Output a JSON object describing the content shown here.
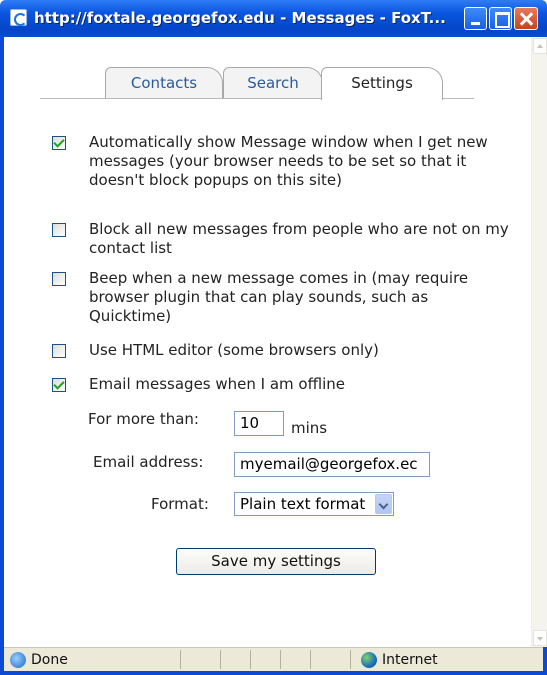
{
  "window": {
    "title": "http://foxtale.georgefox.edu - Messages - FoxT..."
  },
  "tabs": [
    {
      "label": "Contacts",
      "active": false
    },
    {
      "label": "Search",
      "active": false
    },
    {
      "label": "Settings",
      "active": true
    }
  ],
  "options": [
    {
      "label": "Automatically show Message window when I get new messages (your browser needs to be set so that it doesn't block popups on this site)",
      "checked": true
    },
    {
      "label": "Block all new messages from people who are not on my contact list",
      "checked": false
    },
    {
      "label": "Beep when a new message comes in (may require browser plugin that can play sounds, such as Quicktime)",
      "checked": false
    },
    {
      "label": "Use HTML editor (some browsers only)",
      "checked": false
    },
    {
      "label": "Email messages when I am offline",
      "checked": true
    }
  ],
  "offline": {
    "for_more_than_label": "For more than:",
    "minutes_value": "10",
    "minutes_unit": "mins",
    "email_label": "Email address:",
    "email_value": "myemail@georgefox.ec",
    "format_label": "Format:",
    "format_value": "Plain text format"
  },
  "save_button": "Save my settings",
  "status": {
    "left_text": "Done",
    "zone_text": "Internet"
  },
  "colors": {
    "titlebar": "#0a55e0",
    "tab_link": "#2a5a9a",
    "checkmark": "#21a121"
  }
}
